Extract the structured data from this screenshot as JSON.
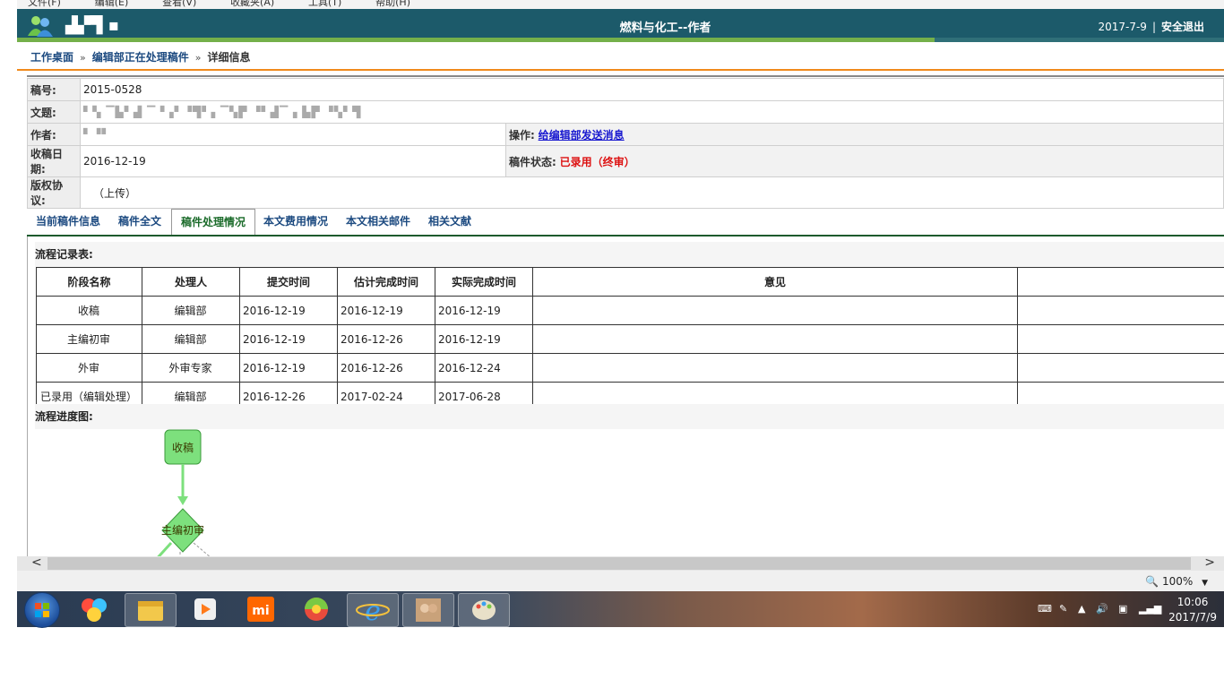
{
  "browser_menu": [
    "文件(F)",
    "编辑(E)",
    "查看(V)",
    "收藏夹(A)",
    "工具(T)",
    "帮助(H)"
  ],
  "header": {
    "title": "燃料与化工--作者",
    "date": "2017-7-9",
    "separator": "|",
    "logout": "安全退出"
  },
  "breadcrumb": {
    "items": [
      "工作桌面",
      "编辑部正在处理稿件"
    ],
    "current": "详细信息",
    "arrow": "»"
  },
  "info": {
    "manuscript_no_label": "稿号:",
    "manuscript_no": "2015-0528",
    "title_label": "文题:",
    "author_label": "作者:",
    "operation_label": "操作:",
    "operation_link": "给编辑部发送消息",
    "received_label": "收稿日期:",
    "received_date": "2016-12-19",
    "status_label": "稿件状态:",
    "status_value": "已录用（终审）",
    "copyright_label": "版权协议:",
    "copyright_value": "（上传）"
  },
  "tabs": [
    "当前稿件信息",
    "稿件全文",
    "稿件处理情况",
    "本文费用情况",
    "本文相关邮件",
    "相关文献"
  ],
  "active_tab": "稿件处理情况",
  "flow": {
    "section_title": "流程记录表:",
    "columns": [
      "阶段名称",
      "处理人",
      "提交时间",
      "估计完成时间",
      "实际完成时间",
      "意见",
      ""
    ],
    "rows": [
      [
        "收稿",
        "编辑部",
        "2016-12-19",
        "2016-12-19",
        "2016-12-19",
        "",
        ""
      ],
      [
        "主编初审",
        "编辑部",
        "2016-12-19",
        "2016-12-26",
        "2016-12-19",
        "",
        ""
      ],
      [
        "外审",
        "外审专家",
        "2016-12-19",
        "2016-12-26",
        "2016-12-24",
        "",
        ""
      ],
      [
        "已录用（编辑处理）",
        "编辑部",
        "2016-12-26",
        "2017-02-24",
        "2017-06-28",
        "",
        ""
      ]
    ],
    "progress_title": "流程进度图:",
    "nodes": [
      "收稿",
      "主编初审"
    ],
    "node_color": "#7de07d"
  },
  "scrollbar": {
    "left": "<",
    "right": ">"
  },
  "statusbar": {
    "zoom": "100%"
  },
  "taskbar": {
    "time": "10:06",
    "date": "2017/7/9"
  },
  "colors": {
    "header_bg": "#1c5a6a",
    "accent_orange": "#f08a1c",
    "link_blue": "#1c4a80",
    "status_red": "#d11111",
    "active_tab_green": "#1b6b2a"
  }
}
